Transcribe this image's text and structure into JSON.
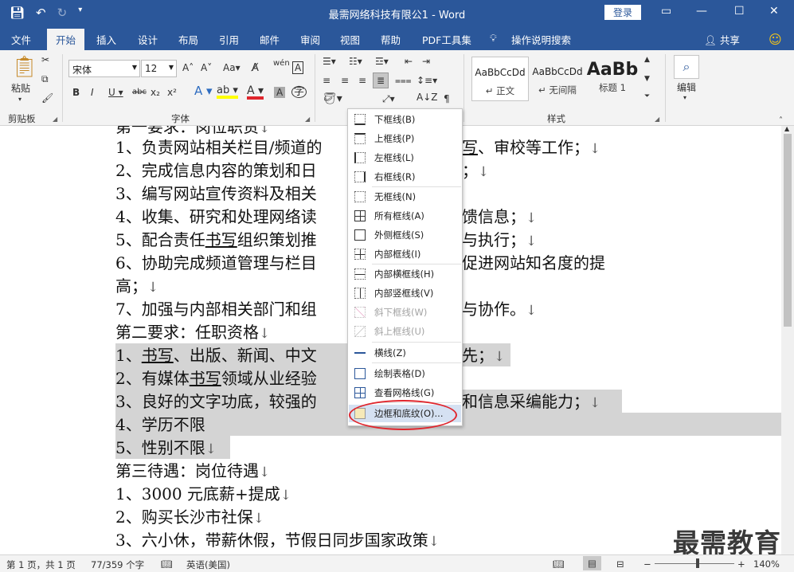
{
  "window": {
    "title": "最需网络科技有限公1 - Word",
    "login_label": "登录",
    "qat_icons": [
      "save-icon",
      "undo-icon",
      "redo-icon",
      "customize-icon"
    ]
  },
  "tabs": [
    "文件",
    "开始",
    "插入",
    "设计",
    "布局",
    "引用",
    "邮件",
    "审阅",
    "视图",
    "帮助",
    "PDF工具集"
  ],
  "tell_me": "操作说明搜索",
  "share": "共享",
  "ribbon": {
    "paste": "粘贴",
    "clipboard_label": "剪贴板",
    "font_name": "宋体",
    "font_size": "12",
    "font_label": "字体",
    "styles": [
      {
        "preview": "AaBbCcDd",
        "name": "正文"
      },
      {
        "preview": "AaBbCcDd",
        "name": "无间隔"
      },
      {
        "preview": "AaBb",
        "name": "标题 1"
      }
    ],
    "styles_label": "样式",
    "edit_label": "编辑"
  },
  "document": {
    "lines": [
      "第一要求：岗位职责",
      "1、负责网站相关栏目/频道的",
      "2、完成信息内容的策划和日",
      "3、编写网站宣传资料及相关",
      "4、收集、研究和处理网络读",
      "5、配合责任",
      "6、协助完成频道管理与栏目",
      "高；",
      "7、加强与内部相关部门和组",
      "第二要求：任职资格",
      "1、",
      "2、有媒体",
      "3、良好的文字功底，较强的",
      "4、学历不限",
      "5、性别不限",
      "第三待遇：岗位待遇",
      "1、3000 元底薪+提成",
      "2、购买长沙市社保",
      "3、六小休，带薪休假，节假日同步国家政策"
    ],
    "right_fragments": {
      "l1_u": "书写",
      "l1": "、审校等工作；",
      "l2": "；",
      "l4": "馈信息；",
      "l5_u": "书写",
      "l5a": "组织策划推",
      "l5b": "与执行；",
      "l6": "促进网站知名度的提",
      "l7": "与协作。",
      "s1_u": "书写",
      "s1a": "、出版、新闻、中文",
      "s1b": "先；",
      "s2_u": "书写",
      "s2a": "领域从业经验",
      "s3": "和信息采编能力；"
    }
  },
  "border_menu": {
    "items": [
      {
        "label": "下框线(B)",
        "icon": "bottom-border-icon",
        "disabled": false
      },
      {
        "label": "上框线(P)",
        "icon": "top-border-icon",
        "disabled": false
      },
      {
        "label": "左框线(L)",
        "icon": "left-border-icon",
        "disabled": false
      },
      {
        "label": "右框线(R)",
        "icon": "right-border-icon",
        "disabled": false
      },
      {
        "label": "无框线(N)",
        "icon": "no-border-icon",
        "disabled": false
      },
      {
        "label": "所有框线(A)",
        "icon": "all-borders-icon",
        "disabled": false
      },
      {
        "label": "外侧框线(S)",
        "icon": "outside-borders-icon",
        "disabled": false
      },
      {
        "label": "内部框线(I)",
        "icon": "inside-borders-icon",
        "disabled": false
      },
      {
        "label": "内部横框线(H)",
        "icon": "inside-horizontal-border-icon",
        "disabled": false
      },
      {
        "label": "内部竖框线(V)",
        "icon": "inside-vertical-border-icon",
        "disabled": false
      },
      {
        "label": "斜下框线(W)",
        "icon": "diagonal-down-border-icon",
        "disabled": true
      },
      {
        "label": "斜上框线(U)",
        "icon": "diagonal-up-border-icon",
        "disabled": true
      },
      {
        "label": "横线(Z)",
        "icon": "horizontal-line-icon",
        "disabled": false
      },
      {
        "label": "绘制表格(D)",
        "icon": "draw-table-icon",
        "disabled": false
      },
      {
        "label": "查看网格线(G)",
        "icon": "view-gridlines-icon",
        "disabled": false
      },
      {
        "label": "边框和底纹(O)...",
        "icon": "borders-shading-icon",
        "disabled": false
      }
    ]
  },
  "status": {
    "page": "第 1 页，共 1 页",
    "words": "77/359 个字",
    "language": "英语(美国)",
    "zoom": "140%"
  },
  "watermark": "最需教育",
  "colors": {
    "titlebar": "#2b579a",
    "highlight_circle": "#e0262d",
    "shading": "#d4d4d4"
  }
}
